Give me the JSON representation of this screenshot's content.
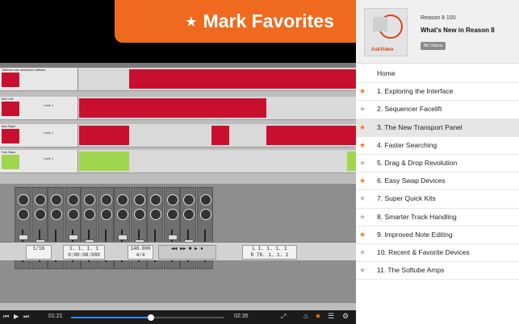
{
  "banner": {
    "star": "★",
    "text": "Mark Favorites"
  },
  "course": {
    "subtitle": "Reason 8 100",
    "title": "What's New in Reason 8",
    "author": "Mo Volans",
    "logo": "AskVideo"
  },
  "toc": [
    {
      "label": "Home",
      "favorite": null,
      "selected": false
    },
    {
      "label": "1. Exploring the Interface",
      "favorite": true,
      "selected": false
    },
    {
      "label": "2. Sequencer Facelift",
      "favorite": false,
      "selected": false
    },
    {
      "label": "3. The New Transport Panel",
      "favorite": true,
      "selected": true
    },
    {
      "label": "4. Faster Searching",
      "favorite": true,
      "selected": false
    },
    {
      "label": "5. Drag & Drop Revolution",
      "favorite": false,
      "selected": false
    },
    {
      "label": "6. Easy Swap Devices",
      "favorite": true,
      "selected": false
    },
    {
      "label": "7. Super Quick Kits",
      "favorite": false,
      "selected": false
    },
    {
      "label": "8. Smarter Track Handling",
      "favorite": false,
      "selected": false
    },
    {
      "label": "9. Improved Note Editing",
      "favorite": true,
      "selected": false
    },
    {
      "label": "10. Recent & Favorite Devices",
      "favorite": false,
      "selected": false
    },
    {
      "label": "11. The Softube Amps",
      "favorite": false,
      "selected": false
    }
  ],
  "star_glyph": "★",
  "player": {
    "elapsed": "01:21",
    "total": "02:35",
    "progress_fraction": 0.52
  },
  "daw": {
    "tracks": [
      {
        "name": "Tabless wav stretched halftime",
        "lane": "",
        "color": "#c8102e"
      },
      {
        "name": "Mai Left",
        "lane": "Lane 1",
        "color": "#c8102e"
      },
      {
        "name": "Mai Right",
        "lane": "Lane 1",
        "color": "#c8102e"
      },
      {
        "name": "Sub Bass",
        "lane": "Lane 1",
        "color": "#9fd64e"
      }
    ],
    "transport": {
      "quantize": "1/16",
      "position_top": "1.  1.  1.  1",
      "time": "0:00:00:000",
      "tempo": "148.000",
      "signature": "4/4",
      "loop_l": "L   1.  1.  1.  1",
      "loop_r": "R   79.  1.  1.  1"
    }
  },
  "colors": {
    "accent": "#ef6a1f",
    "progress": "#2f8ff0",
    "clip_red": "#c8102e",
    "clip_green": "#9fd64e"
  }
}
